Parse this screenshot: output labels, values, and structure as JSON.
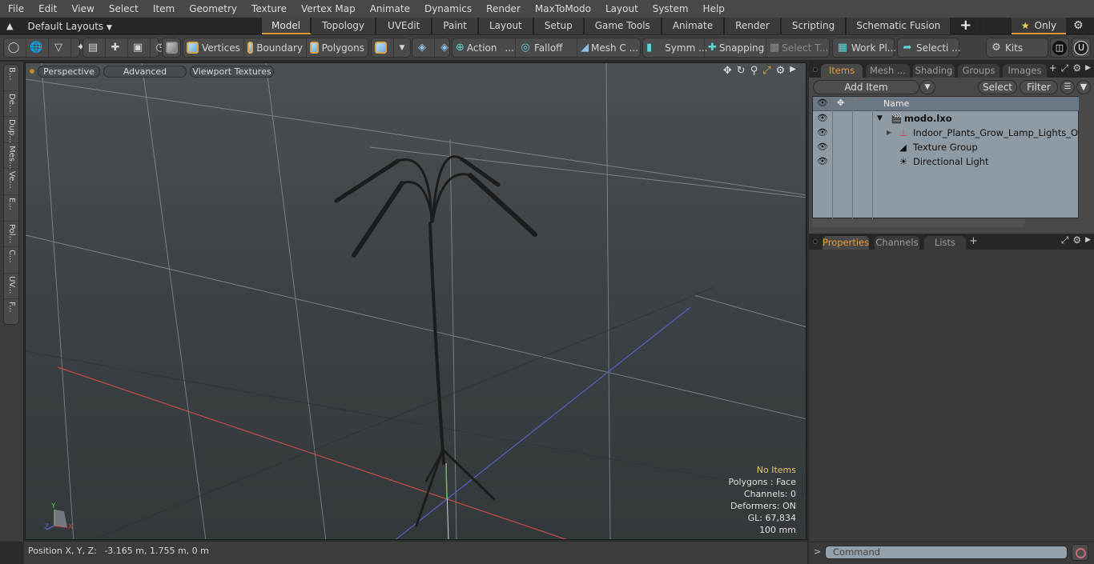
{
  "menubar": {
    "items": [
      "File",
      "Edit",
      "View",
      "Select",
      "Item",
      "Geometry",
      "Texture",
      "Vertex Map",
      "Animate",
      "Dynamics",
      "Render",
      "MaxToModo",
      "Layout",
      "System",
      "Help"
    ]
  },
  "layoutbar": {
    "layouts_dropdown": "Default Layouts",
    "tabs": [
      {
        "label": "Model",
        "active": true
      },
      {
        "label": "Topology"
      },
      {
        "label": "UVEdit"
      },
      {
        "label": "Paint"
      },
      {
        "label": "Layout"
      },
      {
        "label": "Setup"
      },
      {
        "label": "Game Tools"
      },
      {
        "label": "Animate"
      },
      {
        "label": "Render"
      },
      {
        "label": "Scripting"
      },
      {
        "label": "Schematic Fusion"
      }
    ],
    "add_tab": "+",
    "only_label": "Only"
  },
  "toolbar": {
    "vertices": "Vertices",
    "boundary": "Boundary",
    "polygons": "Polygons",
    "action": "Action",
    "action_more": "...",
    "falloff": "Falloff",
    "mesh_c": "Mesh C ...",
    "symm": "Symm ...",
    "snapping": "Snapping",
    "select_t": "Select T...",
    "work_pl": "Work Pl...",
    "selecti": "Selecti ...",
    "kits": "Kits"
  },
  "left_tools": [
    "B...",
    "De...",
    "Dup...",
    "Mes...",
    "Ve...",
    "E...",
    "Pol...",
    "C...",
    "UV...",
    "F..."
  ],
  "viewport": {
    "view_mode": "Perspective",
    "shading": "Advanced",
    "textures": "Viewport Textures",
    "info": {
      "selection": "No Items",
      "polygons": "Polygons : Face",
      "channels": "Channels: 0",
      "deformers": "Deformers: ON",
      "gl": "GL: 67,834",
      "grid": "100 mm"
    },
    "axis_labels": {
      "x": "X",
      "y": "Y",
      "z": "Z"
    },
    "colors": {
      "x_axis": "#c84a4a",
      "z_axis": "#5560c8",
      "y_axis": "#4ec85a",
      "accent": "#e8c46a"
    }
  },
  "statusbar": {
    "position_label": "Position X, Y, Z:",
    "position_value": "-3.165 m, 1.755 m, 0 m"
  },
  "items_panel": {
    "tabs": [
      {
        "label": "Items",
        "active": true
      },
      {
        "label": "Mesh ..."
      },
      {
        "label": "Shading"
      },
      {
        "label": "Groups"
      },
      {
        "label": "Images"
      }
    ],
    "add_item": "Add Item",
    "select": "Select",
    "filter": "Filter",
    "column_name": "Name",
    "tree": [
      {
        "label": "modo.lxo",
        "level": 0,
        "bold": true,
        "icon": "scene-icon"
      },
      {
        "label": "Indoor_Plants_Grow_Lamp_Lights_Off",
        "level": 1,
        "icon": "locator-icon"
      },
      {
        "label": "Texture Group",
        "level": 1,
        "icon": "texture-group-icon"
      },
      {
        "label": "Directional Light",
        "level": 1,
        "icon": "light-icon"
      }
    ]
  },
  "properties_panel": {
    "tabs": [
      {
        "label": "Properties",
        "active": true
      },
      {
        "label": "Channels"
      },
      {
        "label": "Lists"
      }
    ],
    "add": "+"
  },
  "command": {
    "prompt": ">",
    "placeholder": "Command"
  },
  "accent_color": "#e09a3a"
}
